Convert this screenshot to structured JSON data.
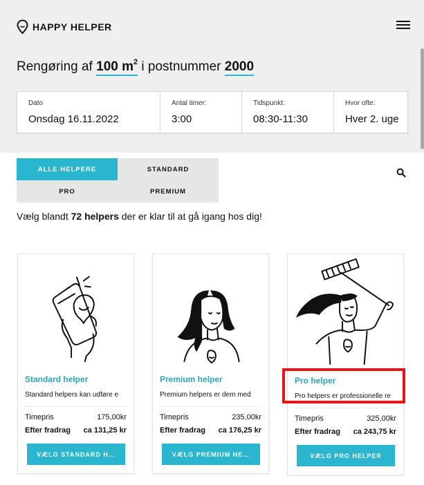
{
  "brand": {
    "name": "HAPPY HELPER",
    "icon": "location-pin-icon"
  },
  "header": {
    "menu_icon": "hamburger-menu-icon",
    "headline": {
      "prefix": "Rengøring af",
      "area": "100 m",
      "area_sup": "2",
      "middle": "i postnummer",
      "postcode": "2000"
    },
    "fields": [
      {
        "label": "Dato",
        "value": "Onsdag 16.11.2022"
      },
      {
        "label": "Antal timer:",
        "value": "3:00"
      },
      {
        "label": "Tidspunkt:",
        "value": "08:30-11:30"
      },
      {
        "label": "Hvor ofte:",
        "value": "Hver 2. uge"
      }
    ]
  },
  "filters": {
    "items": [
      {
        "label": "ALLE HELPERE",
        "active": true
      },
      {
        "label": "STANDARD",
        "active": false
      },
      {
        "label": "PRO",
        "active": false
      },
      {
        "label": "PREMIUM",
        "active": false
      }
    ],
    "search_icon": "search-icon"
  },
  "count_line": {
    "prefix": "Vælg blandt",
    "count": "72 helpers",
    "suffix": "der er klar til at gå igang hos dig!"
  },
  "cards": [
    {
      "title": "Standard helper",
      "description": "Standard helpers kan udføre e",
      "rows": [
        {
          "label": "Timepris",
          "value": "175,00kr"
        },
        {
          "label": "Efter fradrag",
          "value": "ca 131,25 kr"
        }
      ],
      "button": "VÆLG STANDARD H…",
      "illustration": "hand-holding-phone-illustration"
    },
    {
      "title": "Premium helper",
      "description": "Premium helpers er dem med",
      "rows": [
        {
          "label": "Timepris",
          "value": "235,00kr"
        },
        {
          "label": "Efter fradrag",
          "value": "ca 176,25 kr"
        }
      ],
      "button": "VÆLG PREMIUM HE…",
      "illustration": "woman-portrait-illustration"
    },
    {
      "title": "Pro helper",
      "description": "Pro helpers er professionelle re",
      "rows": [
        {
          "label": "Timepris",
          "value": "325,00kr"
        },
        {
          "label": "Efter fradrag",
          "value": "ca 243,75 kr"
        }
      ],
      "button": "VÆLG PRO HELPER",
      "illustration": "woman-with-broom-illustration"
    }
  ],
  "colors": {
    "accent": "#2ab6cf",
    "highlight": "#e8141b",
    "header_bg": "#efefef"
  }
}
